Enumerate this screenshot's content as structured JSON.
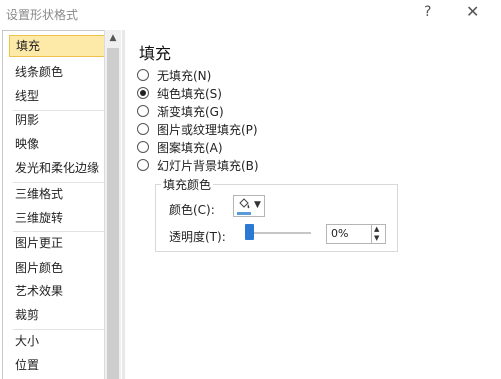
{
  "window": {
    "title": "设置形状格式",
    "help_label": "?",
    "close_label": "✕"
  },
  "sidebar": {
    "items": [
      {
        "label": "填充",
        "selected": true
      },
      {
        "label": "线条颜色"
      },
      {
        "label": "线型"
      },
      {
        "label": "阴影"
      },
      {
        "label": "映像"
      },
      {
        "label": "发光和柔化边缘"
      },
      {
        "label": "三维格式"
      },
      {
        "label": "三维旋转"
      },
      {
        "label": "图片更正"
      },
      {
        "label": "图片颜色"
      },
      {
        "label": "艺术效果"
      },
      {
        "label": "裁剪"
      },
      {
        "label": "大小"
      },
      {
        "label": "位置"
      }
    ],
    "scroll_up_icon": "▲"
  },
  "panel": {
    "title": "填充",
    "options": [
      {
        "label": "无填充(N)",
        "checked": false
      },
      {
        "label": "纯色填充(S)",
        "checked": true
      },
      {
        "label": "渐变填充(G)",
        "checked": false
      },
      {
        "label": "图片或纹理填充(P)",
        "checked": false
      },
      {
        "label": "图案填充(A)",
        "checked": false
      },
      {
        "label": "幻灯片背景填充(B)",
        "checked": false
      }
    ],
    "fill_color_group": {
      "title": "填充颜色",
      "color_label": "颜色(C):",
      "color_value": "#5b9bd5",
      "dropdown_icon": "▼",
      "transparency_label": "透明度(T):",
      "transparency_value": "0%",
      "transparency_fraction": 0,
      "spin_up_icon": "▲",
      "spin_down_icon": "▼"
    }
  }
}
